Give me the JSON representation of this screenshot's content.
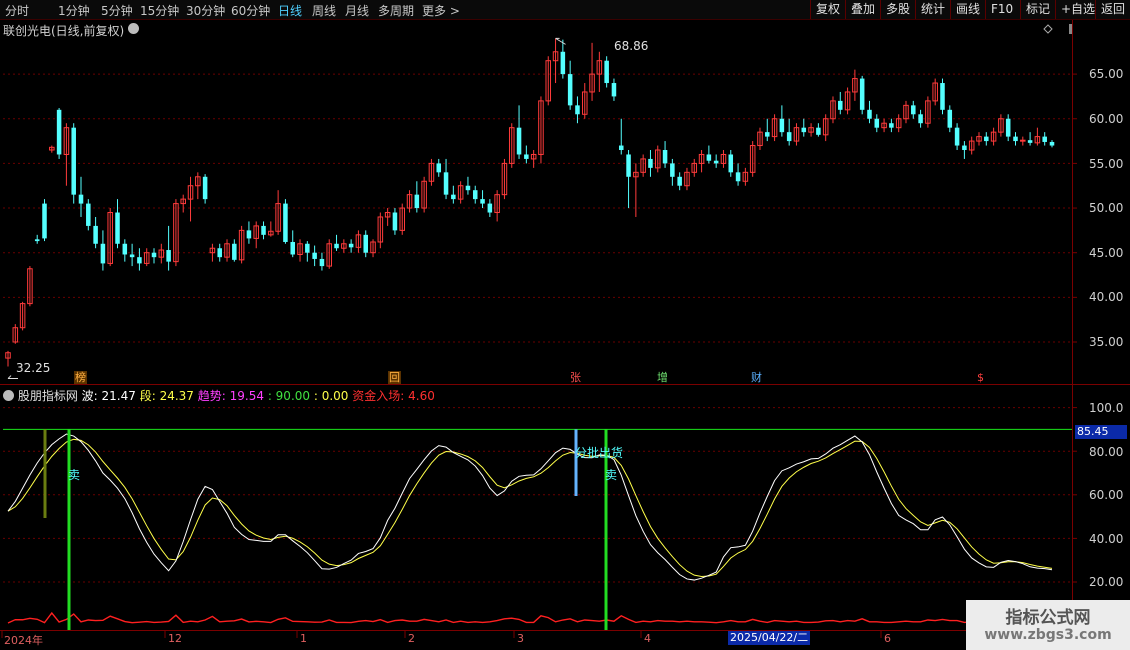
{
  "toolbar": {
    "periods": [
      "分时",
      "1分钟",
      "5分钟",
      "15分钟",
      "30分钟",
      "60分钟",
      "日线",
      "周线",
      "月线",
      "多周期",
      "更多 >"
    ],
    "active_period": "日线",
    "right_buttons": [
      "复权",
      "叠加",
      "多股",
      "统计",
      "画线",
      "F10",
      "标记",
      "+自选",
      "返回"
    ]
  },
  "stock": {
    "title": "联创光电(日线,前复权)"
  },
  "price_axis": {
    "labels": [
      "65.00",
      "60.00",
      "55.00",
      "50.00",
      "45.00",
      "40.00",
      "35.00"
    ]
  },
  "annotations": {
    "high": "68.86",
    "low": "32.25"
  },
  "markers": [
    {
      "label": "榜",
      "color": "#f0a030"
    },
    {
      "label": "回",
      "color": "#f0a030"
    },
    {
      "label": "张",
      "color": "#e04040"
    },
    {
      "label": "增",
      "color": "#60d060"
    },
    {
      "label": "财",
      "color": "#4fa8ff"
    },
    {
      "label": "$",
      "color": "#e04040"
    }
  ],
  "indicator": {
    "name": "股朋指标网",
    "bo_label": "波: ",
    "bo_value": "21.47",
    "duan_label": "段: ",
    "duan_value": "24.37",
    "trend_label": "趋势: ",
    "trend_value": "19.54",
    "level_value": ": 90.00",
    "zero_value": ": 0.00",
    "fund_label": "资金入场: ",
    "fund_value": "4.60",
    "axis_labels": [
      "100.0",
      "80.00",
      "60.00",
      "40.00",
      "20.00"
    ],
    "current_value": "85.45",
    "text_sell_1": "卖",
    "text_sell_2": "卖",
    "text_batch": "分批出货"
  },
  "time_axis": {
    "labels": [
      "2024年",
      "12",
      "1",
      "2",
      "3",
      "4",
      "6"
    ],
    "cursor_date": "2025/04/22/二"
  },
  "watermark": {
    "title": "指标公式网",
    "url": "www.zbgs3.com"
  },
  "colors": {
    "up": "#ff3b3b",
    "down": "#54ffff",
    "bo_line": "#ffffff",
    "duan_line": "#ffff4a",
    "level_line": "#19e619",
    "fund_line": "#ff2020"
  },
  "chart_data": {
    "type": "candlestick",
    "period": "daily",
    "price_axis_ticks": [
      35,
      40,
      45,
      50,
      55,
      60,
      65
    ],
    "high": 68.86,
    "low": 32.25,
    "indicator_axis_ticks": [
      20,
      40,
      60,
      80,
      100
    ],
    "indicator_level": 90,
    "series_names": [
      "波",
      "段",
      "趋势",
      "资金入场"
    ],
    "last_values": {
      "波": 21.47,
      "段": 24.37,
      "趋势": 19.54,
      "资金入场": 4.6
    },
    "ohlc": [
      [
        33.2,
        34.0,
        32.25,
        33.8
      ],
      [
        35.0,
        37.0,
        34.8,
        36.6
      ],
      [
        36.6,
        39.5,
        36.3,
        39.3
      ],
      [
        39.3,
        43.5,
        39.0,
        43.2
      ],
      [
        46.5,
        47.0,
        46.0,
        46.3
      ],
      [
        50.5,
        51.0,
        46.3,
        46.6
      ],
      [
        56.5,
        57.0,
        56.2,
        56.8
      ],
      [
        61.0,
        61.2,
        55.5,
        56.0
      ],
      [
        56.0,
        59.5,
        52.5,
        59.0
      ],
      [
        59.0,
        59.5,
        50.5,
        51.5
      ],
      [
        51.5,
        53.5,
        49.0,
        50.5
      ],
      [
        50.5,
        51.0,
        47.5,
        48.0
      ],
      [
        48.0,
        49.0,
        45.5,
        46.0
      ],
      [
        46.0,
        47.5,
        43.0,
        43.8
      ],
      [
        43.8,
        50.0,
        43.5,
        49.5
      ],
      [
        49.5,
        51.0,
        45.5,
        46.0
      ],
      [
        46.0,
        46.5,
        44.0,
        44.8
      ],
      [
        44.8,
        46.0,
        43.5,
        44.5
      ],
      [
        44.5,
        45.5,
        43.0,
        43.8
      ],
      [
        43.8,
        45.5,
        43.5,
        45.0
      ],
      [
        45.0,
        45.5,
        43.8,
        44.5
      ],
      [
        44.5,
        46.0,
        43.8,
        45.3
      ],
      [
        45.3,
        48.0,
        43.0,
        44.0
      ],
      [
        44.0,
        51.0,
        43.5,
        50.5
      ],
      [
        50.5,
        51.5,
        49.5,
        51.0
      ],
      [
        51.0,
        53.5,
        48.5,
        52.5
      ],
      [
        52.5,
        54.0,
        51.0,
        53.5
      ],
      [
        53.5,
        53.8,
        50.5,
        51.0
      ],
      [
        45.0,
        46.0,
        44.0,
        45.5
      ],
      [
        45.5,
        46.0,
        44.0,
        44.5
      ],
      [
        44.5,
        46.5,
        44.0,
        46.0
      ],
      [
        46.0,
        46.5,
        44.0,
        44.2
      ],
      [
        44.2,
        48.0,
        43.8,
        47.5
      ],
      [
        47.5,
        48.5,
        46.0,
        46.6
      ],
      [
        46.6,
        48.5,
        45.5,
        48.0
      ],
      [
        48.0,
        48.5,
        46.5,
        47.0
      ],
      [
        47.0,
        48.5,
        46.8,
        47.4
      ],
      [
        47.4,
        52.0,
        47.0,
        50.5
      ],
      [
        50.5,
        51.0,
        46.0,
        46.2
      ],
      [
        46.2,
        47.5,
        44.5,
        44.8
      ],
      [
        44.8,
        46.5,
        44.0,
        46.0
      ],
      [
        46.0,
        46.3,
        44.0,
        45.0
      ],
      [
        45.0,
        45.8,
        43.5,
        44.3
      ],
      [
        44.3,
        45.0,
        43.0,
        43.5
      ],
      [
        43.5,
        46.5,
        43.2,
        46.0
      ],
      [
        46.0,
        47.0,
        45.2,
        45.5
      ],
      [
        45.5,
        46.5,
        45.0,
        46.0
      ],
      [
        46.0,
        46.5,
        45.0,
        45.6
      ],
      [
        45.6,
        47.5,
        45.0,
        47.0
      ],
      [
        47.0,
        47.5,
        44.5,
        45.0
      ],
      [
        45.0,
        46.5,
        44.5,
        46.2
      ],
      [
        46.2,
        49.5,
        45.5,
        49.0
      ],
      [
        49.0,
        50.0,
        48.0,
        49.5
      ],
      [
        49.5,
        50.0,
        47.0,
        47.5
      ],
      [
        47.5,
        50.5,
        47.0,
        50.0
      ],
      [
        50.0,
        52.0,
        49.5,
        51.5
      ],
      [
        51.5,
        53.0,
        49.5,
        50.0
      ],
      [
        50.0,
        53.5,
        49.5,
        53.0
      ],
      [
        53.0,
        55.5,
        52.5,
        55.0
      ],
      [
        55.0,
        55.5,
        53.5,
        54.0
      ],
      [
        54.0,
        55.5,
        51.0,
        51.5
      ],
      [
        51.5,
        52.5,
        50.5,
        51.0
      ],
      [
        51.0,
        53.0,
        50.5,
        52.5
      ],
      [
        52.5,
        53.5,
        51.5,
        52.0
      ],
      [
        52.0,
        52.5,
        50.5,
        51.0
      ],
      [
        51.0,
        52.0,
        50.0,
        50.5
      ],
      [
        50.5,
        51.0,
        49.0,
        49.5
      ],
      [
        49.5,
        52.0,
        48.5,
        51.5
      ],
      [
        51.5,
        55.5,
        51.0,
        55.0
      ],
      [
        55.0,
        59.5,
        54.5,
        59.0
      ],
      [
        59.0,
        61.5,
        55.5,
        56.0
      ],
      [
        56.0,
        57.0,
        55.0,
        55.5
      ],
      [
        55.5,
        56.5,
        54.5,
        56.0
      ],
      [
        56.0,
        62.5,
        55.0,
        62.0
      ],
      [
        62.0,
        67.0,
        61.5,
        66.5
      ],
      [
        66.5,
        69.0,
        64.0,
        67.5
      ],
      [
        67.5,
        68.86,
        64.5,
        65.0
      ],
      [
        65.0,
        66.5,
        61.0,
        61.5
      ],
      [
        61.5,
        62.5,
        59.5,
        60.5
      ],
      [
        60.5,
        64.0,
        60.0,
        63.0
      ],
      [
        63.0,
        68.5,
        62.0,
        65.0
      ],
      [
        65.0,
        67.5,
        63.0,
        66.5
      ],
      [
        66.5,
        67.0,
        63.5,
        64.0
      ],
      [
        64.0,
        64.5,
        62.0,
        62.5
      ],
      [
        57.0,
        60.0,
        56.0,
        56.5
      ],
      [
        56.0,
        56.5,
        50.0,
        53.5
      ],
      [
        53.5,
        55.0,
        49.0,
        54.0
      ],
      [
        54.0,
        56.0,
        53.5,
        55.5
      ],
      [
        55.5,
        56.5,
        53.5,
        54.5
      ],
      [
        54.5,
        57.0,
        54.0,
        56.5
      ],
      [
        56.5,
        57.5,
        54.5,
        55.0
      ],
      [
        55.0,
        55.5,
        52.5,
        53.5
      ],
      [
        53.5,
        54.0,
        52.0,
        52.5
      ],
      [
        52.5,
        54.5,
        52.0,
        54.0
      ],
      [
        54.0,
        55.5,
        53.5,
        55.0
      ],
      [
        55.0,
        56.5,
        54.0,
        56.0
      ],
      [
        56.0,
        57.0,
        55.0,
        55.3
      ],
      [
        55.3,
        56.0,
        54.5,
        55.0
      ],
      [
        55.0,
        56.5,
        54.5,
        56.0
      ],
      [
        56.0,
        56.5,
        53.5,
        54.0
      ],
      [
        54.0,
        55.0,
        52.5,
        53.0
      ],
      [
        53.0,
        54.5,
        52.5,
        54.0
      ],
      [
        54.0,
        57.5,
        53.5,
        57.0
      ],
      [
        57.0,
        59.0,
        56.5,
        58.5
      ],
      [
        58.5,
        60.0,
        57.5,
        58.0
      ],
      [
        58.0,
        60.5,
        57.5,
        60.0
      ],
      [
        60.0,
        61.5,
        58.0,
        58.5
      ],
      [
        58.5,
        60.0,
        57.0,
        57.5
      ],
      [
        57.5,
        59.5,
        57.0,
        59.0
      ],
      [
        59.0,
        60.0,
        58.0,
        58.5
      ],
      [
        58.5,
        59.5,
        58.0,
        59.0
      ],
      [
        59.0,
        59.5,
        58.0,
        58.2
      ],
      [
        58.2,
        60.5,
        57.5,
        60.0
      ],
      [
        60.0,
        62.5,
        59.5,
        62.0
      ],
      [
        62.0,
        63.0,
        60.5,
        61.0
      ],
      [
        61.0,
        63.5,
        60.5,
        63.0
      ],
      [
        63.0,
        65.5,
        62.0,
        64.5
      ],
      [
        64.5,
        64.8,
        60.5,
        61.0
      ],
      [
        61.0,
        62.0,
        59.5,
        60.0
      ],
      [
        60.0,
        60.5,
        58.5,
        59.0
      ],
      [
        59.0,
        60.0,
        58.5,
        59.5
      ],
      [
        59.5,
        60.0,
        58.5,
        59.0
      ],
      [
        59.0,
        60.5,
        58.5,
        60.0
      ],
      [
        60.0,
        62.0,
        59.5,
        61.5
      ],
      [
        61.5,
        62.0,
        60.0,
        60.5
      ],
      [
        60.5,
        61.0,
        59.0,
        59.5
      ],
      [
        59.5,
        62.5,
        59.0,
        62.0
      ],
      [
        62.0,
        64.5,
        61.5,
        64.0
      ],
      [
        64.0,
        64.5,
        60.5,
        61.0
      ],
      [
        61.0,
        61.5,
        58.5,
        59.0
      ],
      [
        59.0,
        59.5,
        56.5,
        57.0
      ],
      [
        57.0,
        57.5,
        55.5,
        56.5
      ],
      [
        56.5,
        58.0,
        56.0,
        57.5
      ],
      [
        57.5,
        58.5,
        57.0,
        58.0
      ],
      [
        58.0,
        58.5,
        57.0,
        57.5
      ],
      [
        57.5,
        59.0,
        57.0,
        58.5
      ],
      [
        58.5,
        60.5,
        58.0,
        60.0
      ],
      [
        60.0,
        60.5,
        57.5,
        58.0
      ],
      [
        58.0,
        58.5,
        57.0,
        57.5
      ],
      [
        57.5,
        58.0,
        57.0,
        57.6
      ],
      [
        57.6,
        58.5,
        57.0,
        57.3
      ],
      [
        57.3,
        59.0,
        57.0,
        58.0
      ],
      [
        58.0,
        58.5,
        57.0,
        57.4
      ],
      [
        57.4,
        57.6,
        56.8,
        57.0
      ]
    ]
  }
}
